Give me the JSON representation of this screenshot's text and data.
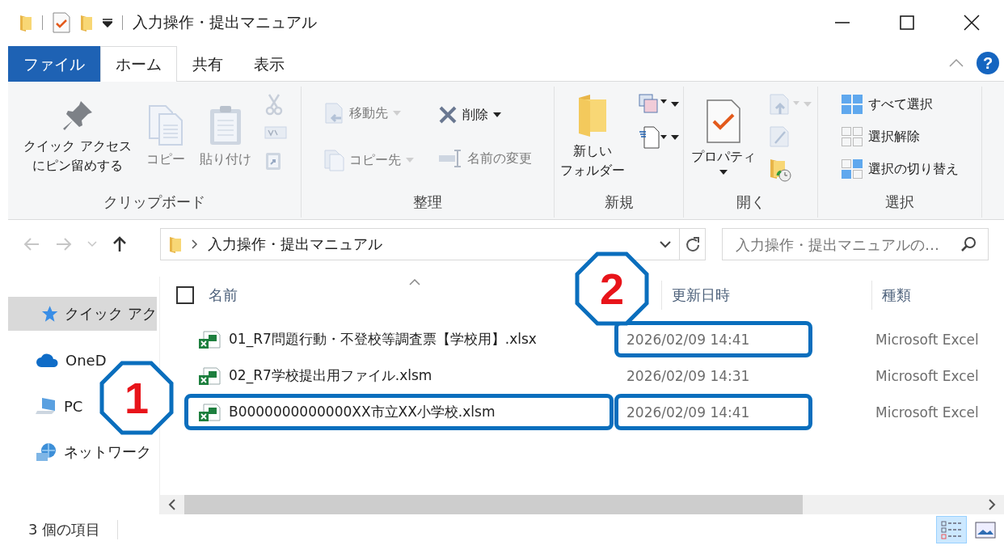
{
  "window": {
    "title": "入力操作・提出マニュアル"
  },
  "ribbon_tabs": [
    {
      "label": "ファイル",
      "kind": "file",
      "selected": false
    },
    {
      "label": "ホーム",
      "kind": "tab",
      "selected": true
    },
    {
      "label": "共有",
      "kind": "tab",
      "selected": false
    },
    {
      "label": "表示",
      "kind": "tab",
      "selected": false
    }
  ],
  "help_button": {
    "label": "?"
  },
  "ribbon_groups": [
    {
      "label": "クリップボード",
      "columns": [
        {
          "kind": "large",
          "commands": [
            {
              "lines": [
                "クイック アクセス",
                "にピン留めする"
              ],
              "disabled": false,
              "dropdown": false
            }
          ]
        },
        {
          "kind": "large",
          "commands": [
            {
              "lines": [
                "コピー"
              ],
              "disabled": true,
              "dropdown": false
            }
          ]
        },
        {
          "kind": "large",
          "commands": [
            {
              "lines": [
                "貼り付け"
              ],
              "disabled": true,
              "dropdown": false
            }
          ]
        },
        {
          "kind": "icons",
          "commands": [
            {
              "disabled": true,
              "dropdown": false
            },
            {
              "disabled": true,
              "dropdown": false
            },
            {
              "disabled": true,
              "dropdown": false
            }
          ]
        }
      ]
    },
    {
      "label": "整理",
      "columns": [
        {
          "kind": "small",
          "commands": [
            {
              "lines": [
                "移動先"
              ],
              "disabled": true,
              "dropdown": true
            },
            {
              "lines": [
                "コピー先"
              ],
              "disabled": true,
              "dropdown": true
            }
          ]
        },
        {
          "kind": "small",
          "commands": [
            {
              "lines": [
                "削除"
              ],
              "disabled": false,
              "dropdown": true
            },
            {
              "lines": [
                "名前の変更"
              ],
              "disabled": true,
              "dropdown": false
            }
          ]
        }
      ]
    },
    {
      "label": "新規",
      "columns": [
        {
          "kind": "large",
          "commands": [
            {
              "lines": [
                "新しい",
                "フォルダー"
              ],
              "disabled": false,
              "dropdown": false
            }
          ]
        },
        {
          "kind": "icons",
          "commands": [
            {
              "disabled": false,
              "dropdown": true
            },
            {
              "disabled": false,
              "dropdown": true
            }
          ]
        }
      ]
    },
    {
      "label": "開く",
      "columns": [
        {
          "kind": "large",
          "commands": [
            {
              "lines": [
                "プロパティ"
              ],
              "disabled": false,
              "dropdown": true
            }
          ]
        },
        {
          "kind": "icons",
          "commands": [
            {
              "disabled": true,
              "dropdown": true
            },
            {
              "disabled": true,
              "dropdown": false
            },
            {
              "disabled": false,
              "dropdown": false
            }
          ]
        }
      ]
    },
    {
      "label": "選択",
      "columns": [
        {
          "kind": "small",
          "commands": [
            {
              "lines": [
                "すべて選択"
              ],
              "disabled": false,
              "dropdown": false
            },
            {
              "lines": [
                "選択解除"
              ],
              "disabled": false,
              "dropdown": false
            },
            {
              "lines": [
                "選択の切り替え"
              ],
              "disabled": false,
              "dropdown": false
            }
          ]
        }
      ]
    }
  ],
  "navigation": [
    {
      "kind": "back",
      "disabled": true
    },
    {
      "kind": "forward",
      "disabled": true
    },
    {
      "kind": "recent",
      "disabled": true
    },
    {
      "kind": "up",
      "disabled": false
    }
  ],
  "address": {
    "segments": [
      "入力操作・提出マニュアル"
    ]
  },
  "search": {
    "placeholder": "入力操作・提出マニュアルの…"
  },
  "sidebar": {
    "items": [
      {
        "label": "クイック アク",
        "kind": "quick-access",
        "selected": true
      },
      {
        "label": "OneD",
        "kind": "cloud",
        "selected": false
      },
      {
        "label": "PC",
        "kind": "pc",
        "selected": false
      },
      {
        "label": "ネットワーク",
        "kind": "network",
        "selected": false
      }
    ]
  },
  "table": {
    "select_all": {
      "checked": false
    },
    "columns": [
      {
        "label": "名前",
        "sorted": true
      },
      {
        "label": "更新日時",
        "sorted": false
      },
      {
        "label": "種類",
        "sorted": false
      }
    ],
    "rows": [
      {
        "name": "01_R7問題行動・不登校等調査票【学校用】.xlsx",
        "modified": "2026/02/09 14:41",
        "type": "Microsoft Excel",
        "selected": false,
        "name_highlighted": false,
        "modified_highlighted": true
      },
      {
        "name": "02_R7学校提出用ファイル.xlsm",
        "modified": "2026/02/09 14:31",
        "type": "Microsoft Excel",
        "selected": false,
        "name_highlighted": false,
        "modified_highlighted": false
      },
      {
        "name": "B0000000000000XX市立XX小学校.xlsm",
        "modified": "2026/02/09 14:41",
        "type": "Microsoft Excel",
        "selected": false,
        "name_highlighted": true,
        "modified_highlighted": true
      }
    ]
  },
  "status_bar": {
    "item_count": "3 個の項目",
    "views": [
      {
        "kind": "details",
        "selected": true
      },
      {
        "kind": "tiles",
        "selected": false
      }
    ]
  },
  "callouts": [
    {
      "label": "1"
    },
    {
      "label": "2"
    }
  ]
}
